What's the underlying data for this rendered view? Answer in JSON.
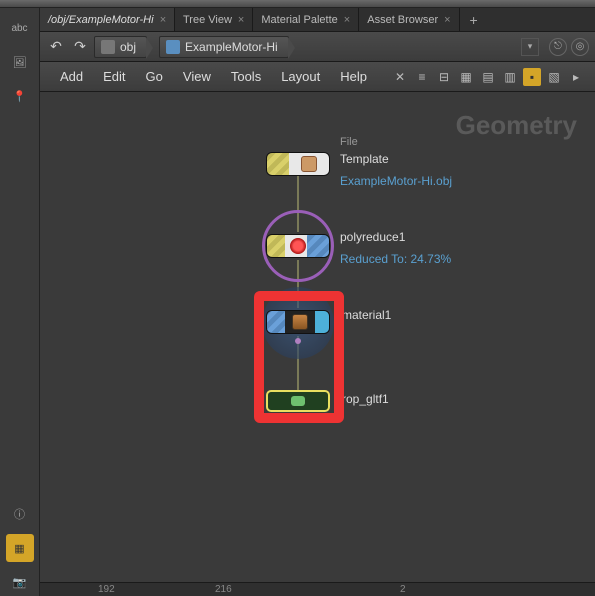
{
  "tabs": {
    "t0": "/obj/ExampleMotor-Hi",
    "t1": "Tree View",
    "t2": "Material Palette",
    "t3": "Asset Browser"
  },
  "breadcrumb": {
    "root": "obj",
    "current": "ExampleMotor-Hi"
  },
  "menus": {
    "add": "Add",
    "edit": "Edit",
    "go": "Go",
    "view": "View",
    "tools": "Tools",
    "layout": "Layout",
    "help": "Help"
  },
  "context_label": "Geometry",
  "nodes": {
    "n1_tag": "File",
    "n1_label": "Template",
    "n1_sub": "ExampleMotor-Hi.obj",
    "n2_label": "polyreduce1",
    "n2_sub": "Reduced To: 24.73%",
    "n3_label": "material1",
    "n4_label": "rop_gltf1"
  },
  "ruler": {
    "a": "192",
    "b": "216",
    "c": "2"
  },
  "left_rail_text": "abc"
}
